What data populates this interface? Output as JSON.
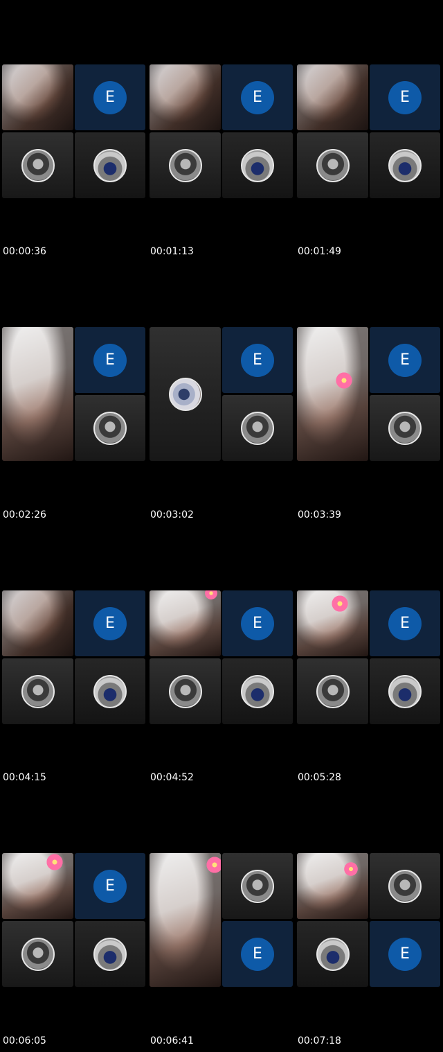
{
  "thumbnails": [
    {
      "timestamp": "00:00:36",
      "initial": "E"
    },
    {
      "timestamp": "00:01:13",
      "initial": "E"
    },
    {
      "timestamp": "00:01:49",
      "initial": "E"
    },
    {
      "timestamp": "00:02:26",
      "initial": "E"
    },
    {
      "timestamp": "00:03:02",
      "initial": "E"
    },
    {
      "timestamp": "00:03:39",
      "initial": "E"
    },
    {
      "timestamp": "00:04:15",
      "initial": "E"
    },
    {
      "timestamp": "00:04:52",
      "initial": "E"
    },
    {
      "timestamp": "00:05:28",
      "initial": "E"
    },
    {
      "timestamp": "00:06:05",
      "initial": "E"
    },
    {
      "timestamp": "00:06:41",
      "initial": "E"
    },
    {
      "timestamp": "00:07:18",
      "initial": "E"
    }
  ],
  "colors": {
    "background": "#000000",
    "initial_tile": "#10233c",
    "initial_badge": "#0e5aa8",
    "participant_tile": "#1e1e1e",
    "timestamp_text": "#ffffff"
  },
  "icons": {
    "flower_filter": "flower-icon",
    "avatar_person": "avatar-icon",
    "avatar_motorcycle": "avatar-icon"
  }
}
